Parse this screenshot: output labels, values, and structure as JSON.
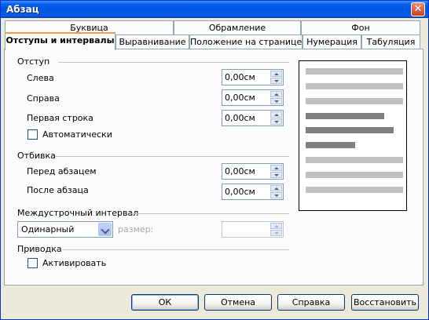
{
  "window": {
    "title": "Абзац",
    "close_glyph": "✕"
  },
  "tabs_top": [
    {
      "label": "Буквица"
    },
    {
      "label": "Обрамление"
    },
    {
      "label": "Фон"
    }
  ],
  "tabs_bottom": [
    {
      "label": "Отступы и интервалы",
      "active": true
    },
    {
      "label": "Выравнивание"
    },
    {
      "label": "Положение на странице"
    },
    {
      "label": "Нумерация"
    },
    {
      "label": "Табуляция"
    }
  ],
  "indent": {
    "heading": "Отступ",
    "left_label": "Слева",
    "left_value": "0,00см",
    "right_label": "Справа",
    "right_value": "0,00см",
    "first_line_label": "Первая строка",
    "first_line_value": "0,00см",
    "auto_label": "Автоматически"
  },
  "spacing": {
    "heading": "Отбивка",
    "before_label": "Перед абзацем",
    "before_value": "0,00см",
    "after_label": "После абзаца",
    "after_value": "0,00см"
  },
  "line_spacing": {
    "heading": "Междустрочный интервал",
    "selected": "Одинарный",
    "size_label": "размер:"
  },
  "register": {
    "heading": "Приводка",
    "activate_label": "Активировать"
  },
  "buttons": {
    "ok": "ОК",
    "cancel": "Отмена",
    "help": "Справка",
    "reset": "Восстановить"
  },
  "colors": {
    "preview_light": "#c0c0c0",
    "preview_dark": "#808080",
    "title_bar": "#0054e3"
  }
}
